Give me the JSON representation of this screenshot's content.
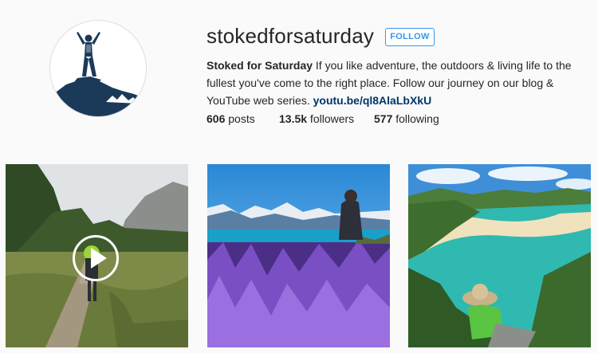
{
  "profile": {
    "username": "stokedforsaturday",
    "follow_label": "FOLLOW",
    "bio_name": "Stoked for Saturday",
    "bio_text": " If you like adventure, the outdoors & living life to the fullest you've come to the right place. Follow our journey on our blog & YouTube web series. ",
    "bio_link": "youtu.be/ql8AlaLbXkU"
  },
  "stats": {
    "posts_count": "606",
    "posts_label": " posts",
    "followers_count": "13.5k",
    "followers_label": " followers",
    "following_count": "577",
    "following_label": " following"
  },
  "colors": {
    "accent": "#3897f0",
    "link": "#003569",
    "avatar_navy": "#1b3a5a"
  },
  "icons": {
    "play": "play-icon"
  }
}
